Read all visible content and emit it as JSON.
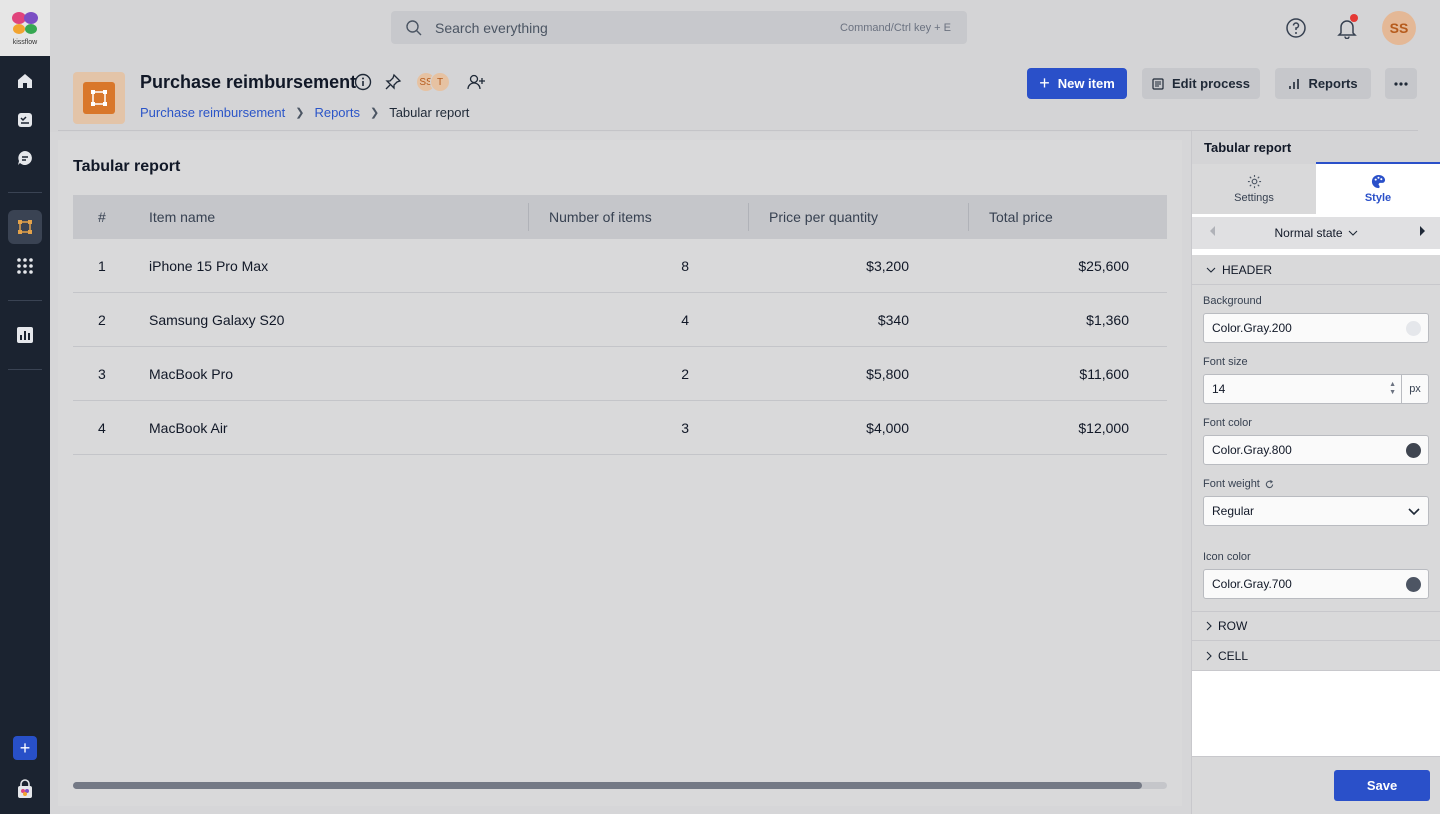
{
  "app": {
    "logo_text": "kissflow"
  },
  "search": {
    "placeholder": "Search everything",
    "shortcut_hint": "Command/Ctrl key + E"
  },
  "user": {
    "initials": "SS"
  },
  "process": {
    "title": "Purchase reimbursement",
    "members": [
      "SS",
      "T"
    ]
  },
  "breadcrumb": {
    "items": [
      "Purchase reimbursement",
      "Reports"
    ],
    "current": "Tabular report"
  },
  "actions": {
    "new_item": "New item",
    "edit_process": "Edit process",
    "reports": "Reports"
  },
  "report": {
    "title": "Tabular report",
    "columns": [
      "#",
      "Item name",
      "Number of items",
      "Price per quantity",
      "Total price"
    ],
    "rows": [
      {
        "n": "1",
        "name": "iPhone 15 Pro Max",
        "qty": "8",
        "price": "$3,200",
        "total": "$25,600"
      },
      {
        "n": "2",
        "name": "Samsung Galaxy S20",
        "qty": "4",
        "price": "$340",
        "total": "$1,360"
      },
      {
        "n": "3",
        "name": "MacBook Pro",
        "qty": "2",
        "price": "$5,800",
        "total": "$11,600"
      },
      {
        "n": "4",
        "name": "MacBook Air",
        "qty": "3",
        "price": "$4,000",
        "total": "$12,000"
      }
    ]
  },
  "panel": {
    "title": "Tabular report",
    "tabs": {
      "settings": "Settings",
      "style": "Style"
    },
    "state": "Normal state",
    "sections": {
      "header": "HEADER",
      "row": "ROW",
      "cell": "CELL"
    },
    "fields": {
      "background_label": "Background",
      "background_value": "Color.Gray.200",
      "font_size_label": "Font size",
      "font_size_value": "14",
      "font_size_unit": "px",
      "font_color_label": "Font color",
      "font_color_value": "Color.Gray.800",
      "font_weight_label": "Font weight",
      "font_weight_value": "Regular",
      "icon_color_label": "Icon color",
      "icon_color_value": "Color.Gray.700"
    },
    "save": "Save"
  },
  "colors": {
    "accent": "#2a50c9",
    "swatch_gray_200": "#e5e7eb",
    "swatch_gray_800": "#3f4550",
    "swatch_gray_700": "#4d5563",
    "notification": "#e53935"
  }
}
